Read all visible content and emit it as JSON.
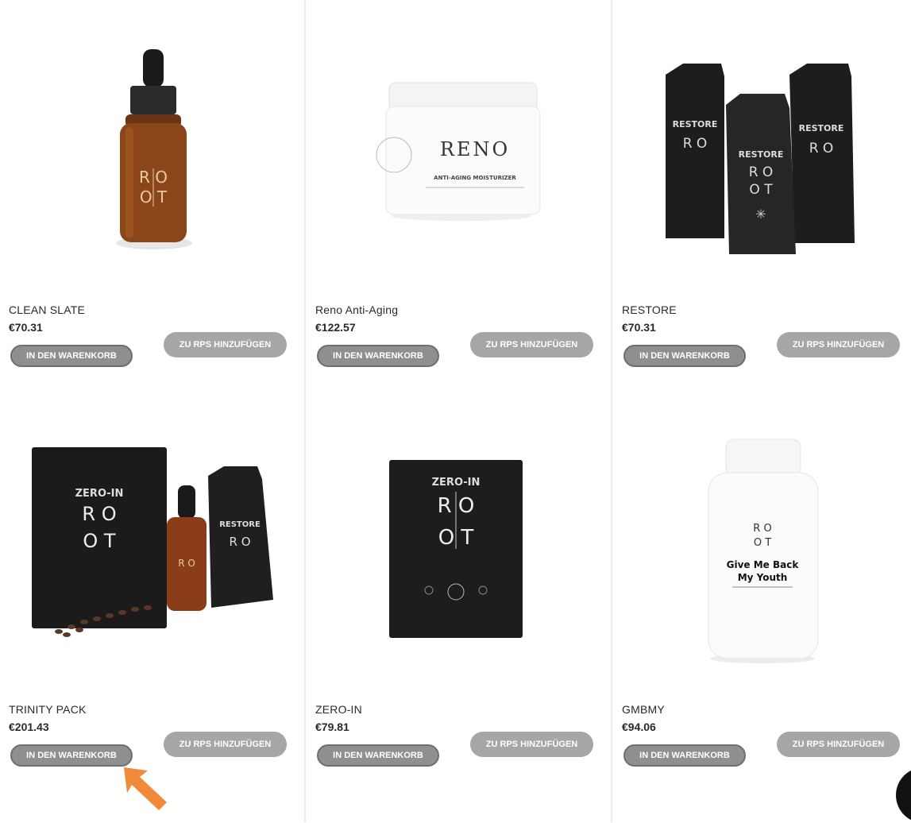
{
  "colors": {
    "button_dark": "#8f8f8f",
    "button_light": "#a6a6a6",
    "hint_arrow": "#f0893a"
  },
  "products": [
    {
      "name": "CLEAN SLATE",
      "price": "€70.31",
      "cart_label": "IN DEN WARENKORB",
      "rps_label": "ZU RPS HINZUFÜGEN",
      "image": "dropper-bottle-amber",
      "image_label_lines": [
        "R O",
        "O T"
      ]
    },
    {
      "name": "Reno Anti-Aging",
      "price": "€122.57",
      "cart_label": "IN DEN WARENKORB",
      "rps_label": "ZU RPS HINZUFÜGEN",
      "image": "white-jar",
      "image_label_lines": [
        "RENO",
        "ANTI-AGING MOISTURIZER"
      ]
    },
    {
      "name": "RESTORE",
      "price": "€70.31",
      "cart_label": "IN DEN WARENKORB",
      "rps_label": "ZU RPS HINZUFÜGEN",
      "image": "three-black-pouches",
      "image_label_lines": [
        "RESTORE",
        "R O",
        "O T"
      ]
    },
    {
      "name": "TRINITY PACK",
      "price": "€201.43",
      "cart_label": "IN DEN WARENKORB",
      "rps_label": "ZU RPS HINZUFÜGEN",
      "image": "bundle-box-bottle-pouch",
      "image_label_lines": [
        "ZERO-IN",
        "R O",
        "O T"
      ]
    },
    {
      "name": "ZERO-IN",
      "price": "€79.81",
      "cart_label": "IN DEN WARENKORB",
      "rps_label": "ZU RPS HINZUFÜGEN",
      "image": "black-box",
      "image_label_lines": [
        "ZERO-IN",
        "R O",
        "O T"
      ]
    },
    {
      "name": "GMBMY",
      "price": "€94.06",
      "cart_label": "IN DEN WARENKORB",
      "rps_label": "ZU RPS HINZUFÜGEN",
      "image": "white-capsule-bottle",
      "image_label_lines": [
        "R O",
        "O T",
        "Give Me Back",
        "My Youth"
      ]
    }
  ]
}
